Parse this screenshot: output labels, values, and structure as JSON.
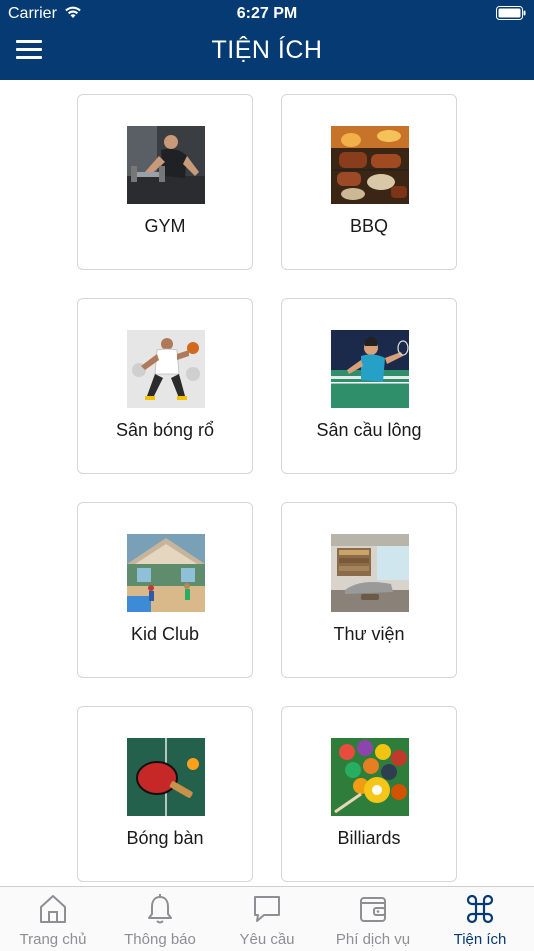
{
  "status_bar": {
    "carrier": "Carrier",
    "time": "6:27 PM"
  },
  "header": {
    "title": "TIỆN ÍCH",
    "menu_icon": "hamburger-menu-icon"
  },
  "amenities": [
    {
      "label": "GYM",
      "image": "gym-photo"
    },
    {
      "label": "BBQ",
      "image": "bbq-photo"
    },
    {
      "label": "Sân bóng rổ",
      "image": "basketball-photo"
    },
    {
      "label": "Sân cầu lông",
      "image": "badminton-photo"
    },
    {
      "label": "Kid Club",
      "image": "kid-club-photo"
    },
    {
      "label": "Thư viện",
      "image": "library-photo"
    },
    {
      "label": "Bóng bàn",
      "image": "table-tennis-photo"
    },
    {
      "label": "Billiards",
      "image": "billiards-photo"
    }
  ],
  "tabbar": {
    "items": [
      {
        "label": "Trang chủ",
        "icon": "home-icon"
      },
      {
        "label": "Thông báo",
        "icon": "bell-icon"
      },
      {
        "label": "Yêu cầu",
        "icon": "chat-bubble-icon"
      },
      {
        "label": "Phí dịch vụ",
        "icon": "wallet-icon"
      },
      {
        "label": "Tiện ích",
        "icon": "command-icon"
      }
    ],
    "active": "Tiện ích"
  },
  "colors": {
    "primary": "#063a73",
    "inactive": "#8e8e93",
    "card_border": "#d6d6d6"
  }
}
